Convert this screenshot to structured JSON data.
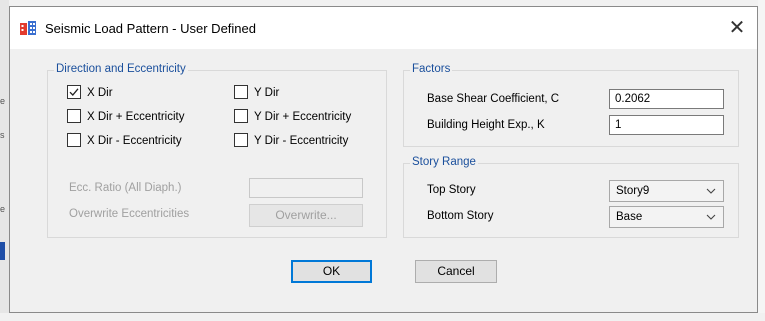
{
  "background_marks": [
    "e",
    "s",
    "e"
  ],
  "dialog": {
    "title": "Seismic Load Pattern - User Defined",
    "close_glyph": "✕",
    "app_icon": "building-icon"
  },
  "direction_group": {
    "title": "Direction and Eccentricity",
    "checkboxes": [
      {
        "label": "X Dir",
        "checked": true
      },
      {
        "label": "Y Dir",
        "checked": false
      },
      {
        "label": "X Dir + Eccentricity",
        "checked": false
      },
      {
        "label": "Y Dir + Eccentricity",
        "checked": false
      },
      {
        "label": "X Dir - Eccentricity",
        "checked": false
      },
      {
        "label": "Y Dir - Eccentricity",
        "checked": false
      }
    ],
    "ecc_ratio_label": "Ecc. Ratio (All Diaph.)",
    "ecc_ratio_value": "",
    "overwrite_label": "Overwrite Eccentricities",
    "overwrite_button": "Overwrite..."
  },
  "factors_group": {
    "title": "Factors",
    "base_shear_label": "Base Shear Coefficient, C",
    "base_shear_value": "0.2062",
    "height_exp_label": "Building Height Exp., K",
    "height_exp_value": "1"
  },
  "story_group": {
    "title": "Story Range",
    "top_label": "Top Story",
    "top_value": "Story9",
    "bottom_label": "Bottom Story",
    "bottom_value": "Base"
  },
  "buttons": {
    "ok": "OK",
    "cancel": "Cancel"
  }
}
